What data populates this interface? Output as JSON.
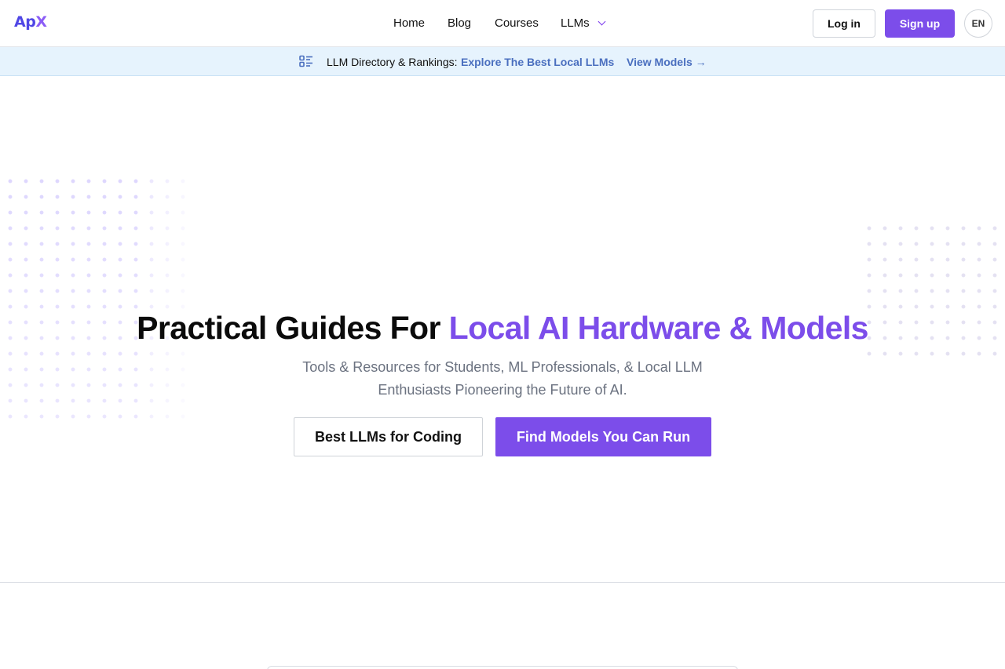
{
  "header": {
    "logo_a": "Ap",
    "logo_x": "X",
    "nav": {
      "home": "Home",
      "blog": "Blog",
      "courses": "Courses",
      "llms": "LLMs"
    },
    "login_label": "Log in",
    "signup_label": "Sign up",
    "language": "EN"
  },
  "banner": {
    "icon": "list-icon",
    "label": "LLM Directory & Rankings:",
    "highlight": "Explore The Best Local LLMs",
    "link": "View Models →"
  },
  "hero": {
    "title_plain": "Practical Guides For ",
    "title_accent": "Local AI Hardware & Models",
    "subtitle": "Tools & Resources for Students, ML Professionals, & Local LLM Enthusiasts Pioneering the Future of AI.",
    "cta_secondary": "Best LLMs for Coding",
    "cta_primary": "Find Models You Can Run"
  },
  "colors": {
    "brand": "#7c4dea",
    "banner_bg": "#e6f3fd",
    "banner_link": "#4a6fbf"
  }
}
